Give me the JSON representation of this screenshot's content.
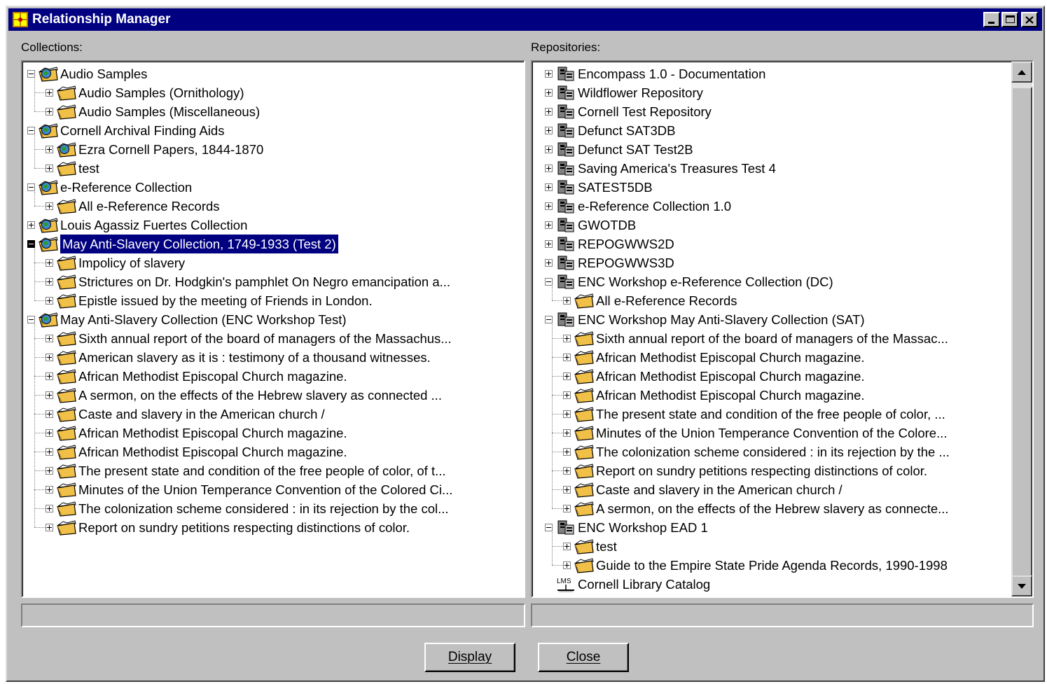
{
  "window": {
    "title": "Relationship Manager"
  },
  "collections": {
    "label": "Collections:",
    "items": [
      {
        "text": "Audio Samples",
        "level": 0,
        "exp": "minus",
        "icon": "folder-globe"
      },
      {
        "text": "Audio Samples (Ornithology)",
        "level": 1,
        "exp": "plus",
        "icon": "folder"
      },
      {
        "text": "Audio Samples (Miscellaneous)",
        "level": 1,
        "exp": "plus",
        "icon": "folder"
      },
      {
        "text": "Cornell Archival Finding Aids",
        "level": 0,
        "exp": "minus",
        "icon": "folder-globe"
      },
      {
        "text": "Ezra Cornell Papers, 1844-1870",
        "level": 1,
        "exp": "plus",
        "icon": "folder-globe"
      },
      {
        "text": "test",
        "level": 1,
        "exp": "plus",
        "icon": "folder"
      },
      {
        "text": "e-Reference Collection",
        "level": 0,
        "exp": "minus",
        "icon": "folder-globe"
      },
      {
        "text": "All e-Reference Records",
        "level": 1,
        "exp": "plus",
        "icon": "folder"
      },
      {
        "text": "Louis Agassiz Fuertes Collection",
        "level": 0,
        "exp": "plus",
        "icon": "folder-globe"
      },
      {
        "text": "May Anti-Slavery Collection, 1749-1933  (Test 2)",
        "level": 0,
        "exp": "minus",
        "icon": "folder-globe",
        "selected": true
      },
      {
        "text": "Impolicy of slavery",
        "level": 1,
        "exp": "plus",
        "icon": "folder"
      },
      {
        "text": "Strictures on Dr. Hodgkin's pamphlet On Negro emancipation a...",
        "level": 1,
        "exp": "plus",
        "icon": "folder"
      },
      {
        "text": "Epistle issued by the meeting of Friends in London.",
        "level": 1,
        "exp": "plus",
        "icon": "folder"
      },
      {
        "text": "May Anti-Slavery Collection (ENC Workshop Test)",
        "level": 0,
        "exp": "minus",
        "icon": "folder-globe"
      },
      {
        "text": "Sixth annual report of the board of managers of the Massachus...",
        "level": 1,
        "exp": "plus",
        "icon": "folder"
      },
      {
        "text": "American slavery as it is : testimony of a thousand witnesses.",
        "level": 1,
        "exp": "plus",
        "icon": "folder"
      },
      {
        "text": "African Methodist Episcopal Church magazine.",
        "level": 1,
        "exp": "plus",
        "icon": "folder"
      },
      {
        "text": "A sermon, on the effects of the Hebrew slavery as connected ...",
        "level": 1,
        "exp": "plus",
        "icon": "folder"
      },
      {
        "text": "Caste and slavery in the American church /",
        "level": 1,
        "exp": "plus",
        "icon": "folder"
      },
      {
        "text": "African Methodist Episcopal Church magazine.",
        "level": 1,
        "exp": "plus",
        "icon": "folder"
      },
      {
        "text": "African Methodist Episcopal Church magazine.",
        "level": 1,
        "exp": "plus",
        "icon": "folder"
      },
      {
        "text": "The present state and condition of the free people of color, of t...",
        "level": 1,
        "exp": "plus",
        "icon": "folder"
      },
      {
        "text": "Minutes of the Union Temperance Convention of the Colored Ci...",
        "level": 1,
        "exp": "plus",
        "icon": "folder"
      },
      {
        "text": "The colonization scheme considered : in its rejection by the col...",
        "level": 1,
        "exp": "plus",
        "icon": "folder"
      },
      {
        "text": "Report on sundry petitions respecting distinctions of color.",
        "level": 1,
        "exp": "plus",
        "icon": "folder"
      }
    ]
  },
  "repositories": {
    "label": "Repositories:",
    "items": [
      {
        "text": "Encompass 1.0 - Documentation",
        "level": 0,
        "exp": "plus",
        "icon": "repository"
      },
      {
        "text": "Wildflower Repository",
        "level": 0,
        "exp": "plus",
        "icon": "repository"
      },
      {
        "text": "Cornell Test Repository",
        "level": 0,
        "exp": "plus",
        "icon": "repository"
      },
      {
        "text": "Defunct SAT3DB",
        "level": 0,
        "exp": "plus",
        "icon": "repository"
      },
      {
        "text": "Defunct SAT Test2B",
        "level": 0,
        "exp": "plus",
        "icon": "repository"
      },
      {
        "text": "Saving America's Treasures Test 4",
        "level": 0,
        "exp": "plus",
        "icon": "repository"
      },
      {
        "text": "SATEST5DB",
        "level": 0,
        "exp": "plus",
        "icon": "repository"
      },
      {
        "text": "e-Reference Collection 1.0",
        "level": 0,
        "exp": "plus",
        "icon": "repository"
      },
      {
        "text": "GWOTDB",
        "level": 0,
        "exp": "plus",
        "icon": "repository"
      },
      {
        "text": "REPOGWWS2D",
        "level": 0,
        "exp": "plus",
        "icon": "repository"
      },
      {
        "text": "REPOGWWS3D",
        "level": 0,
        "exp": "plus",
        "icon": "repository"
      },
      {
        "text": "ENC Workshop e-Reference Collection (DC)",
        "level": 0,
        "exp": "minus",
        "icon": "repository"
      },
      {
        "text": "All e-Reference Records",
        "level": 1,
        "exp": "plus",
        "icon": "folder"
      },
      {
        "text": "ENC Workshop May Anti-Slavery Collection (SAT)",
        "level": 0,
        "exp": "minus",
        "icon": "repository"
      },
      {
        "text": "Sixth annual report of the board of managers of the Massac...",
        "level": 1,
        "exp": "plus",
        "icon": "folder"
      },
      {
        "text": "African Methodist Episcopal Church magazine.",
        "level": 1,
        "exp": "plus",
        "icon": "folder"
      },
      {
        "text": "African Methodist Episcopal Church magazine.",
        "level": 1,
        "exp": "plus",
        "icon": "folder"
      },
      {
        "text": "African Methodist Episcopal Church magazine.",
        "level": 1,
        "exp": "plus",
        "icon": "folder"
      },
      {
        "text": "The present state and condition of the free people of color, ...",
        "level": 1,
        "exp": "plus",
        "icon": "folder"
      },
      {
        "text": "Minutes of the Union Temperance Convention of the Colore...",
        "level": 1,
        "exp": "plus",
        "icon": "folder"
      },
      {
        "text": "The colonization scheme considered : in its rejection by the ...",
        "level": 1,
        "exp": "plus",
        "icon": "folder"
      },
      {
        "text": "Report on sundry petitions respecting distinctions of color.",
        "level": 1,
        "exp": "plus",
        "icon": "folder"
      },
      {
        "text": "Caste and slavery in the American church /",
        "level": 1,
        "exp": "plus",
        "icon": "folder"
      },
      {
        "text": "A sermon, on the effects of the Hebrew slavery as connecte...",
        "level": 1,
        "exp": "plus",
        "icon": "folder"
      },
      {
        "text": "ENC Workshop EAD 1",
        "level": 0,
        "exp": "minus",
        "icon": "repository"
      },
      {
        "text": "test",
        "level": 1,
        "exp": "plus",
        "icon": "folder"
      },
      {
        "text": "Guide to the Empire State Pride Agenda Records, 1990-1998",
        "level": 1,
        "exp": "plus",
        "icon": "folder"
      },
      {
        "text": "Cornell Library Catalog",
        "level": 0,
        "exp": "none",
        "icon": "lms"
      }
    ]
  },
  "lms_icon_text": "LMS",
  "buttons": {
    "display": "Display",
    "close": "Close"
  },
  "colors": {
    "titlebar": "#000080",
    "selection": "#000080",
    "face": "#c0c0c0"
  }
}
